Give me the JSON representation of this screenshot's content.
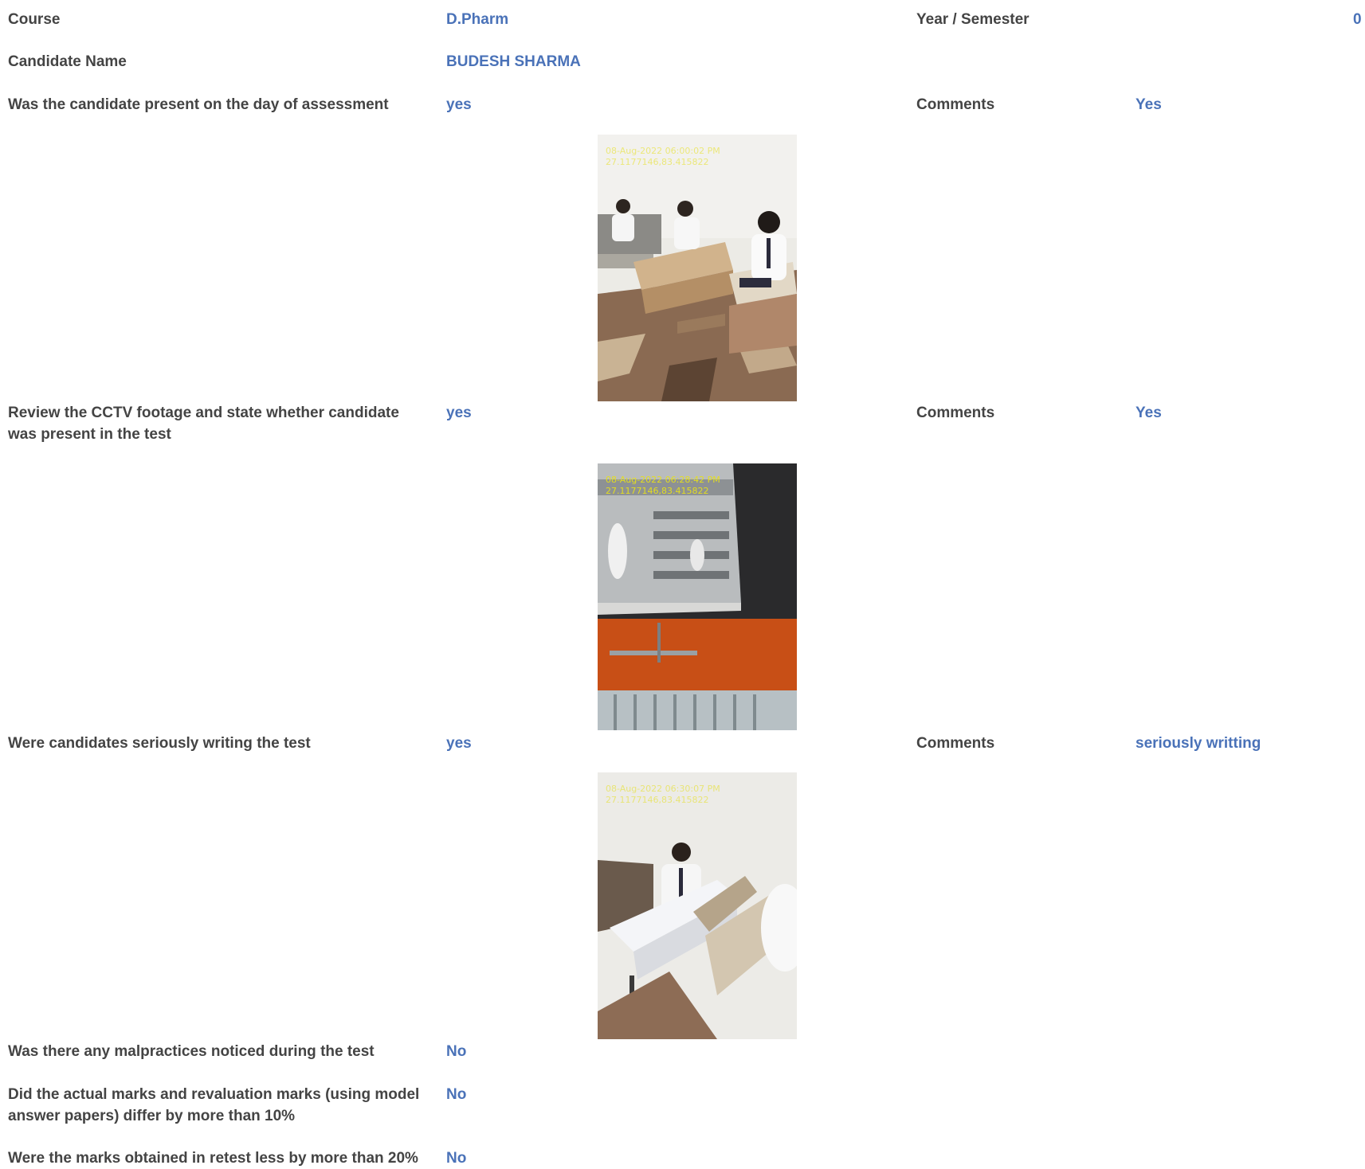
{
  "header": {
    "course_label": "Course",
    "course_value": "D.Pharm",
    "year_label": "Year / Semester",
    "year_value": "0",
    "candidate_label": "Candidate Name",
    "candidate_value": "BUDESH SHARMA"
  },
  "questions": [
    {
      "question": "Was the candidate present on the day of assessment",
      "answer": "yes",
      "comments_label": "Comments",
      "comments": "Yes",
      "photo": {
        "stamp_line1": "08-Aug-2022 06:00:02 PM",
        "stamp_line2": "27.1177146,83.415822"
      }
    },
    {
      "question": "Review the CCTV footage and state whether candidate was present in the test",
      "answer": "yes",
      "comments_label": "Comments",
      "comments": "Yes",
      "photo": {
        "stamp_line1": "08-Aug-2022 06:28:42 PM",
        "stamp_line2": "27.1177146,83.415822"
      }
    },
    {
      "question": "Were candidates seriously writing the test",
      "answer": "yes",
      "comments_label": "Comments",
      "comments": "seriously writting",
      "photo": {
        "stamp_line1": "08-Aug-2022 06:30:07 PM",
        "stamp_line2": "27.1177146,83.415822"
      }
    },
    {
      "question": "Was there any malpractices noticed during the test",
      "answer": "No"
    },
    {
      "question": "Did the actual marks and revaluation marks (using model answer papers) differ by more than 10%",
      "answer": "No"
    },
    {
      "question": "Were the marks obtained in retest less by more than 20%",
      "answer": "No"
    }
  ]
}
